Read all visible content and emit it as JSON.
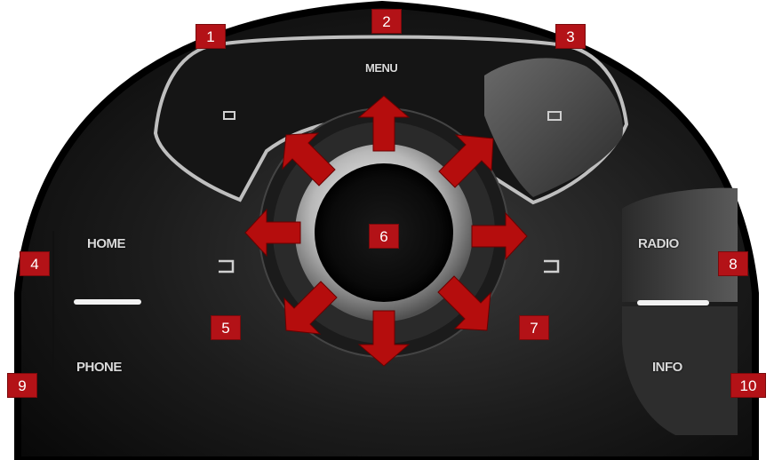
{
  "buttons": {
    "menu": "MENU",
    "home": "HOME",
    "phone": "PHONE",
    "radio": "RADIO",
    "info": "INFO"
  },
  "labels": [
    "1",
    "2",
    "3",
    "4",
    "5",
    "6",
    "7",
    "8",
    "9",
    "10"
  ],
  "colors": {
    "label_red": "#b31217",
    "arrow_red": "#b50d0d",
    "console_black": "#0d0d0d"
  }
}
